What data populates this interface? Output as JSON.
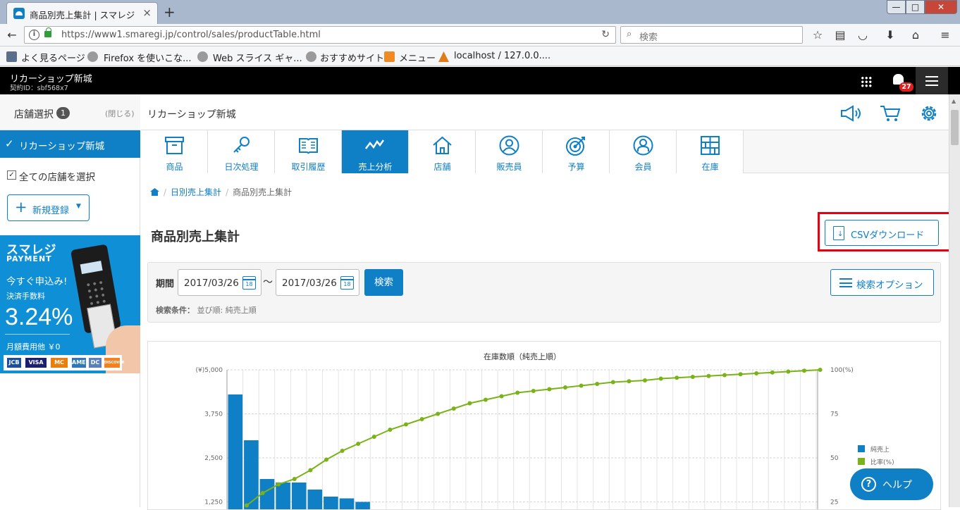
{
  "browser": {
    "tab_title": "商品別売上集計 | スマレジ",
    "tab_close": "×",
    "new_tab": "+",
    "url": "https://www1.smaregi.jp/control/sales/productTable.html",
    "search_placeholder": "検索",
    "bookmarks": [
      {
        "label": "よく見るページ",
        "icon": "bookmark-folder-icon"
      },
      {
        "label": "Firefox を使いこな...",
        "icon": "globe-icon"
      },
      {
        "label": "Web スライス ギャ...",
        "icon": "globe-icon"
      },
      {
        "label": "おすすめサイト",
        "icon": "globe-icon"
      },
      {
        "label": "メニュー",
        "icon": "xampp-icon"
      },
      {
        "label": "localhost / 127.0.0....",
        "icon": "phpmyadmin-icon"
      }
    ]
  },
  "app": {
    "shop_name": "リカーショップ新城",
    "contract_id": "契約ID：sbf568x7",
    "notification_count": "27"
  },
  "sidebar": {
    "store_select_label": "店舗選択",
    "store_count": "1",
    "close_label": "(閉じる)",
    "active_store": "リカーショップ新城",
    "select_all_label": "全ての店舗を選択",
    "new_register_label": "新規登録"
  },
  "banner": {
    "brand": "スマレジ",
    "product": "PAYMENT",
    "apply": "今すぐ申込み!",
    "fee_label": "決済手数料",
    "rate": "3.24%",
    "monthly": "月額費用他 ￥0",
    "cards": [
      "JCB",
      "VISA",
      "MC",
      "AMEX",
      "DC",
      "DISCOVER"
    ]
  },
  "main": {
    "shop_name": "リカーショップ新城",
    "tabs": [
      {
        "label": "商品",
        "icon": "box-icon"
      },
      {
        "label": "日次処理",
        "icon": "key-icon"
      },
      {
        "label": "取引履歴",
        "icon": "book-icon"
      },
      {
        "label": "売上分析",
        "icon": "trend-icon",
        "active": true
      },
      {
        "label": "店舗",
        "icon": "house-icon"
      },
      {
        "label": "販売員",
        "icon": "person-icon"
      },
      {
        "label": "予算",
        "icon": "target-icon"
      },
      {
        "label": "会員",
        "icon": "member-icon"
      },
      {
        "label": "在庫",
        "icon": "shelves-icon"
      }
    ],
    "breadcrumb": [
      "日別売上集計",
      "商品別売上集計"
    ],
    "page_title": "商品別売上集計",
    "csv_label": "CSVダウンロード",
    "search": {
      "period_label": "期間",
      "date_from": "2017/03/26",
      "date_to": "2017/03/26",
      "calendar_day": "18",
      "tilde": "〜",
      "search_label": "検索",
      "condition_label": "検索条件：",
      "condition_value": "並び順: 純売上順",
      "options_label": "検索オプション"
    },
    "help_label": "ヘルプ"
  },
  "chart_data": {
    "type": "bar",
    "title": "在庫数順（純売上順）",
    "y_left_ticks": [
      "(¥)5,000",
      "3,750",
      "2,500",
      "1,250"
    ],
    "y_right_ticks": [
      "100(%)",
      "75",
      "50",
      "25"
    ],
    "ylim_left": [
      0,
      5000
    ],
    "ylim_right": [
      0,
      100
    ],
    "series": [
      {
        "name": "純売上",
        "type": "bar",
        "color": "#0f7fc6",
        "values": [
          4300,
          3000,
          1900,
          1800,
          1800,
          1600,
          1400,
          1350,
          1250
        ]
      },
      {
        "name": "比率(%)",
        "type": "line",
        "color": "#7ab317",
        "values": [
          23,
          30,
          35,
          38,
          43,
          49,
          54,
          58,
          62,
          66,
          69,
          72,
          75,
          78,
          81,
          83,
          85,
          87,
          88,
          89,
          90,
          91,
          92,
          93,
          93.5,
          94,
          95,
          95.5,
          96,
          96.5,
          97,
          97.5,
          98,
          98.5,
          99,
          99.5,
          100
        ]
      }
    ],
    "legend_position": "right",
    "grid": true
  }
}
